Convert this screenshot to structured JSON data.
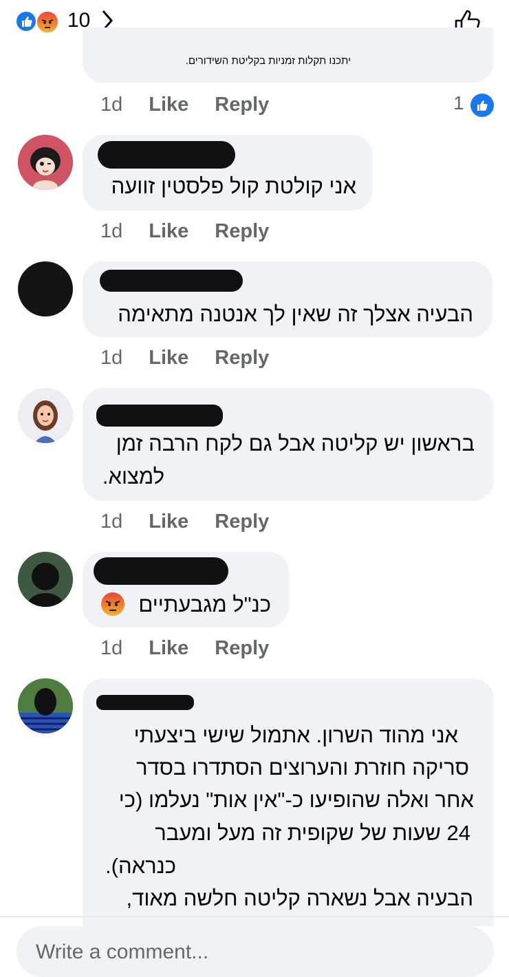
{
  "top_bar": {
    "reaction_count": "10"
  },
  "previous_comment": {
    "truncated_text": "יתכנו תקלות זמניות בקליטת השידורים.",
    "time": "1d",
    "like_label": "Like",
    "reply_label": "Reply",
    "like_count": "1"
  },
  "comments": [
    {
      "text": "אני קולטת קול פלסטין זוועה",
      "time": "1d",
      "like_label": "Like",
      "reply_label": "Reply"
    },
    {
      "text": "הבעיה אצלך זה שאין לך אנטנה מתאימה",
      "time": "1d",
      "like_label": "Like",
      "reply_label": "Reply"
    },
    {
      "text_lines": [
        "בראשון יש קליטה אבל גם לקח הרבה זמן",
        "למצוא."
      ],
      "time": "1d",
      "like_label": "Like",
      "reply_label": "Reply"
    },
    {
      "text": "כנ\"ל מגבעתיים",
      "emoji": "angry-emoji",
      "time": "1d",
      "like_label": "Like",
      "reply_label": "Reply"
    },
    {
      "text_lines": [
        "אני מהוד השרון. אתמול שישי ביצעתי",
        "סריקה חוזרת והערוצים הסתדרו בסדר",
        "אחר ואלה שהופיעו כ-\"אין אות\" נעלמו (כי",
        "24 שעות של שקופית זה מעל ומעבר",
        "כנראה).",
        "הבעיה אבל נשארה קליטה חלשה מאוד,"
      ]
    }
  ],
  "composer": {
    "placeholder": "Write a comment..."
  },
  "colors": {
    "like_blue": "#1877f2",
    "angry_red": "#f5533d",
    "bubble_gray": "#f0f2f5",
    "meta_gray": "#65676b"
  }
}
